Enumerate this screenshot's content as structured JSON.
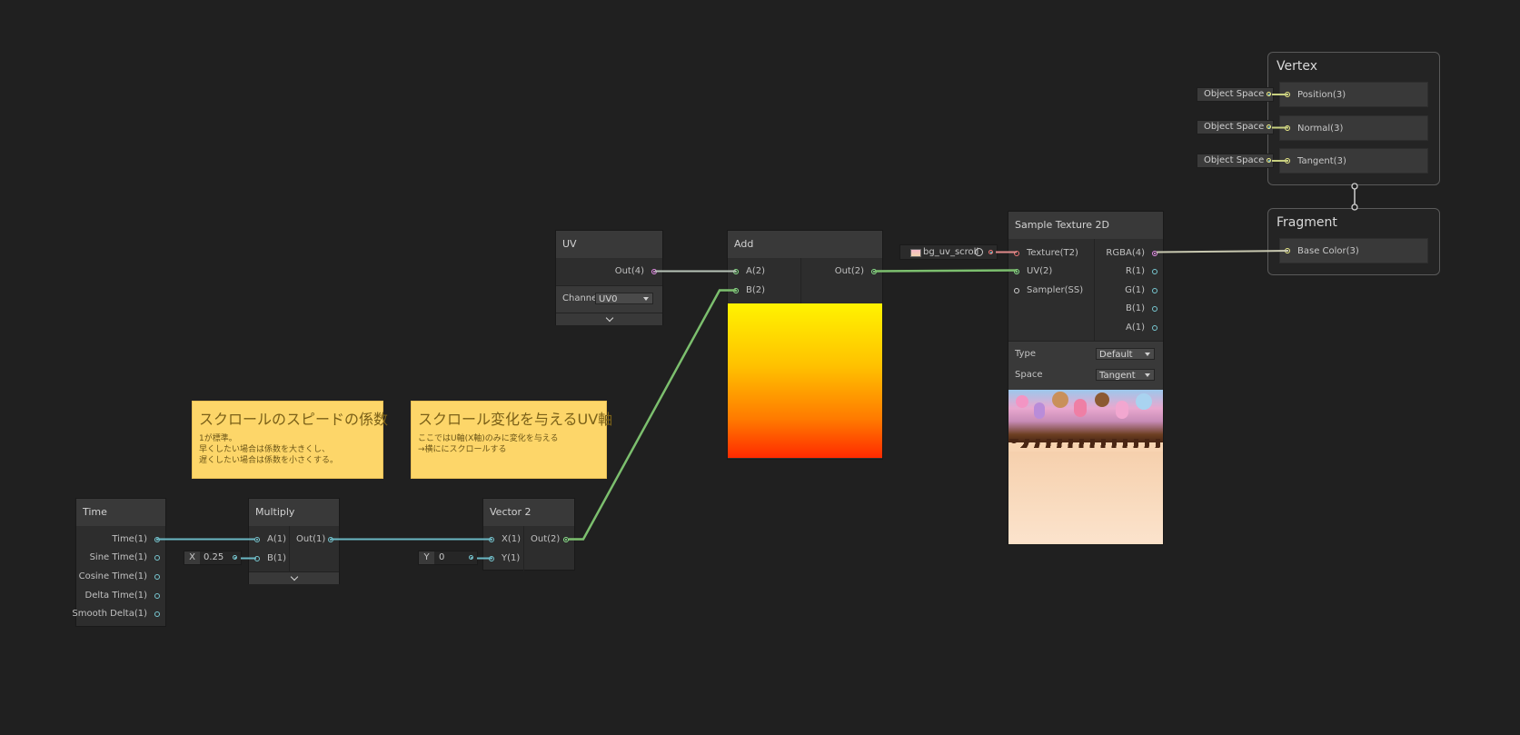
{
  "nodes": {
    "time": {
      "title": "Time",
      "outputs": [
        "Time(1)",
        "Sine Time(1)",
        "Cosine Time(1)",
        "Delta Time(1)",
        "Smooth Delta(1)"
      ]
    },
    "multiply": {
      "title": "Multiply",
      "inputs": [
        "A(1)",
        "B(1)"
      ],
      "output": "Out(1)",
      "b_inline": {
        "axis": "X",
        "value": "0.25"
      }
    },
    "vector2": {
      "title": "Vector 2",
      "inputs": [
        "X(1)",
        "Y(1)"
      ],
      "output": "Out(2)",
      "y_inline": {
        "axis": "Y",
        "value": "0"
      }
    },
    "uv": {
      "title": "UV",
      "output": "Out(4)",
      "channel_label": "Channe",
      "channel_value": "UV0"
    },
    "add": {
      "title": "Add",
      "inputs": [
        "A(2)",
        "B(2)"
      ],
      "output": "Out(2)"
    },
    "sample_texture": {
      "title": "Sample Texture 2D",
      "inputs": [
        "Texture(T2)",
        "UV(2)",
        "Sampler(SS)"
      ],
      "outputs": [
        "RGBA(4)",
        "R(1)",
        "G(1)",
        "B(1)",
        "A(1)"
      ],
      "type_label": "Type",
      "type_value": "Default",
      "space_label": "Space",
      "space_value": "Tangent",
      "texture_property": "bg_uv_scroll"
    }
  },
  "sticky_notes": [
    {
      "title": "スクロールのスピードの係数",
      "body": "1が標準。\n早くしたい場合は係数を大きくし、\n遅くしたい場合は係数を小さくする。"
    },
    {
      "title": "スクロール変化を与えるUV軸",
      "body": "ここではU軸(X軸)のみに変化を与える\n→横ににスクロールする"
    }
  ],
  "master": {
    "vertex": {
      "title": "Vertex",
      "blocks": [
        "Position(3)",
        "Normal(3)",
        "Tangent(3)"
      ],
      "space_label": "Object Space"
    },
    "fragment": {
      "title": "Fragment",
      "blocks": [
        "Base Color(3)"
      ]
    }
  },
  "colors": {
    "background": "#202020",
    "wire_float": "#78c8d2",
    "wire_vector2": "#8ee48e",
    "wire_vector4": "#e48ee6",
    "wire_vector3": "#f0f08a",
    "sticky": "#fdd669"
  },
  "icons": [
    "chevron-down-icon",
    "dropdown-arrow-icon",
    "texture-thumbnail-icon",
    "target-icon"
  ]
}
